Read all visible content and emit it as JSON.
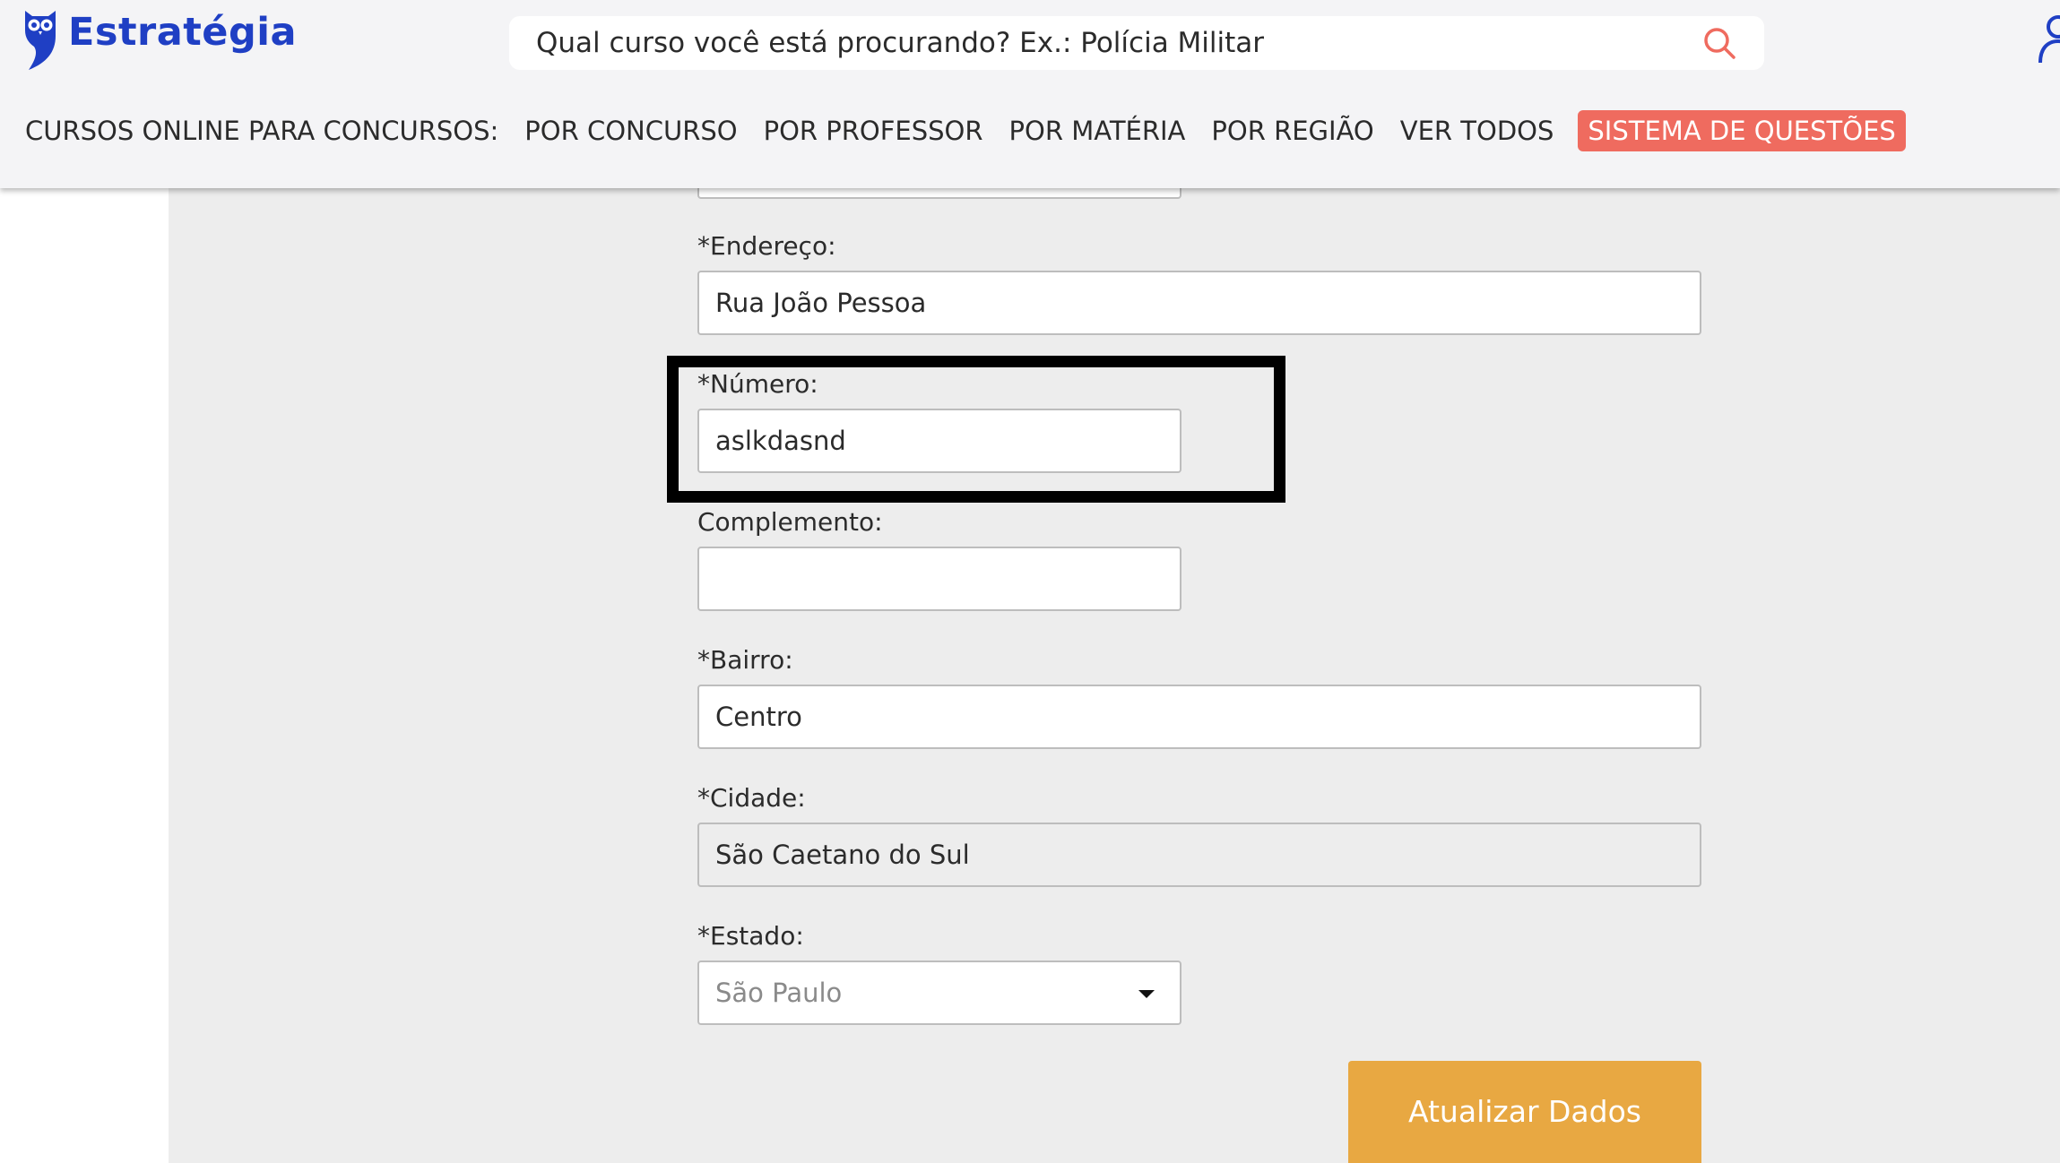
{
  "header": {
    "logo_text": "Estratégia",
    "search": {
      "placeholder": "Qual curso você está procurando? Ex.: Polícia Militar"
    },
    "nav": {
      "label": "CURSOS ONLINE PARA CONCURSOS:",
      "items": [
        "POR CONCURSO",
        "POR PROFESSOR",
        "POR MATÉRIA",
        "POR REGIÃO",
        "VER TODOS"
      ],
      "highlight_item": "SISTEMA DE QUESTÕES"
    }
  },
  "form": {
    "endereco": {
      "label": "*Endereço:",
      "value": "Rua João Pessoa"
    },
    "numero": {
      "label": "*Número:",
      "value": "aslkdasnd"
    },
    "complemento": {
      "label": "Complemento:",
      "value": ""
    },
    "bairro": {
      "label": "*Bairro:",
      "value": "Centro"
    },
    "cidade": {
      "label": "*Cidade:",
      "value": "São Caetano do Sul"
    },
    "estado": {
      "label": "*Estado:",
      "value": "São Paulo"
    },
    "submit_label": "Atualizar Dados"
  },
  "colors": {
    "brand_blue": "#1f3fc4",
    "highlight_nav": "#ef6b5f",
    "submit_button": "#e8a842",
    "search_icon": "#ef6b5f"
  },
  "icons": [
    "owl-logo-icon",
    "search-icon",
    "user-icon",
    "chevron-down-icon"
  ]
}
